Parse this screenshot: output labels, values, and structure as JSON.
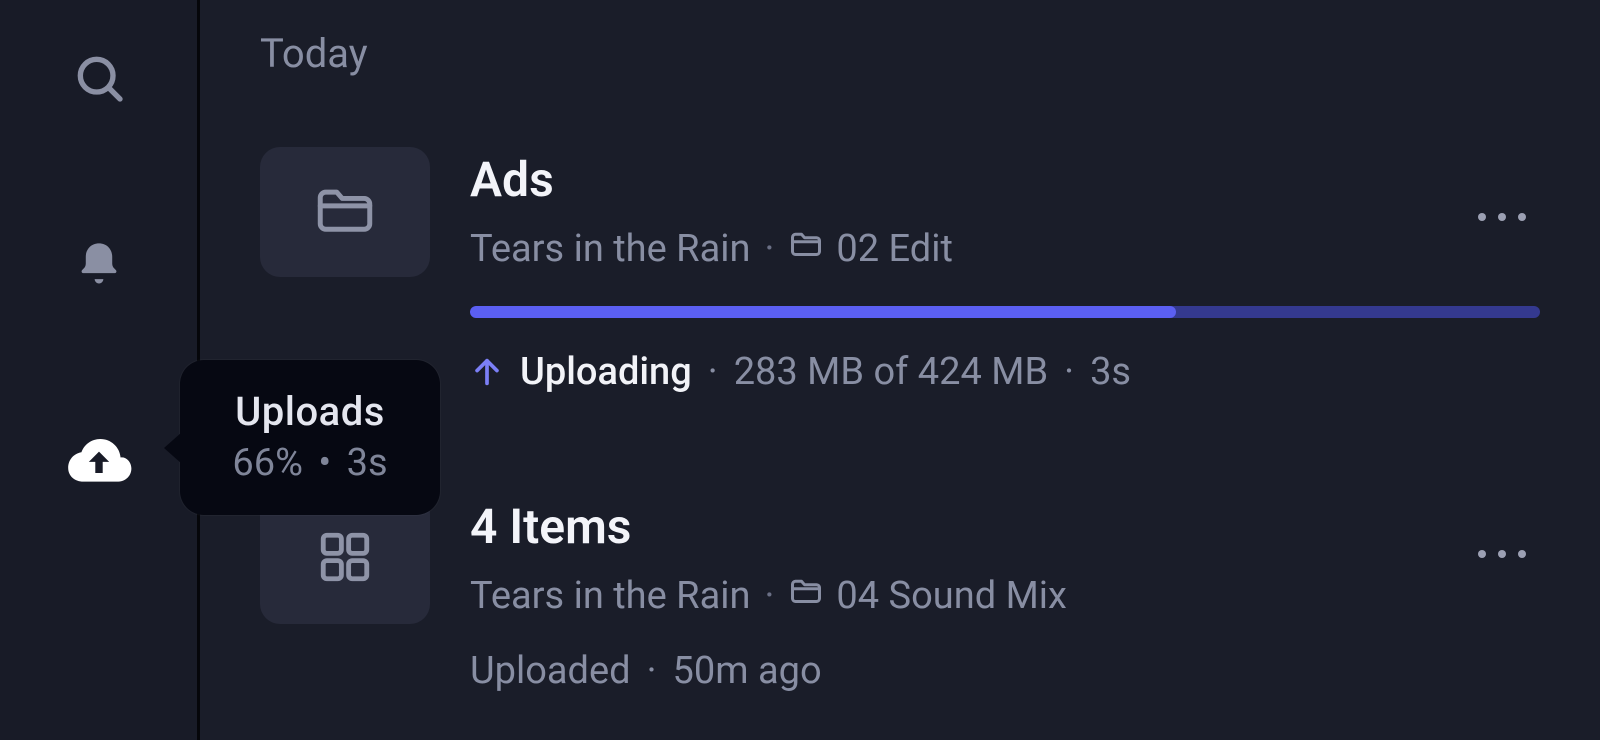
{
  "section_label": "Today",
  "tooltip": {
    "title": "Uploads",
    "percent": "66%",
    "eta": "3s",
    "separator": "•"
  },
  "uploads": [
    {
      "title": "Ads",
      "project": "Tears in the Rain",
      "folder": "02 Edit",
      "thumb_type": "folder",
      "progress_percent": 66,
      "status": {
        "label": "Uploading",
        "size_done": "283 MB",
        "size_total": "424 MB",
        "size_text": "283 MB of 424 MB",
        "eta": "3s",
        "sep": "·"
      }
    },
    {
      "title": "4 Items",
      "project": "Tears in the Rain",
      "folder": "04 Sound Mix",
      "thumb_type": "grid",
      "simple_status": {
        "label": "Uploaded",
        "time": "50m ago",
        "sep": "·"
      }
    }
  ],
  "path_sep": "·"
}
